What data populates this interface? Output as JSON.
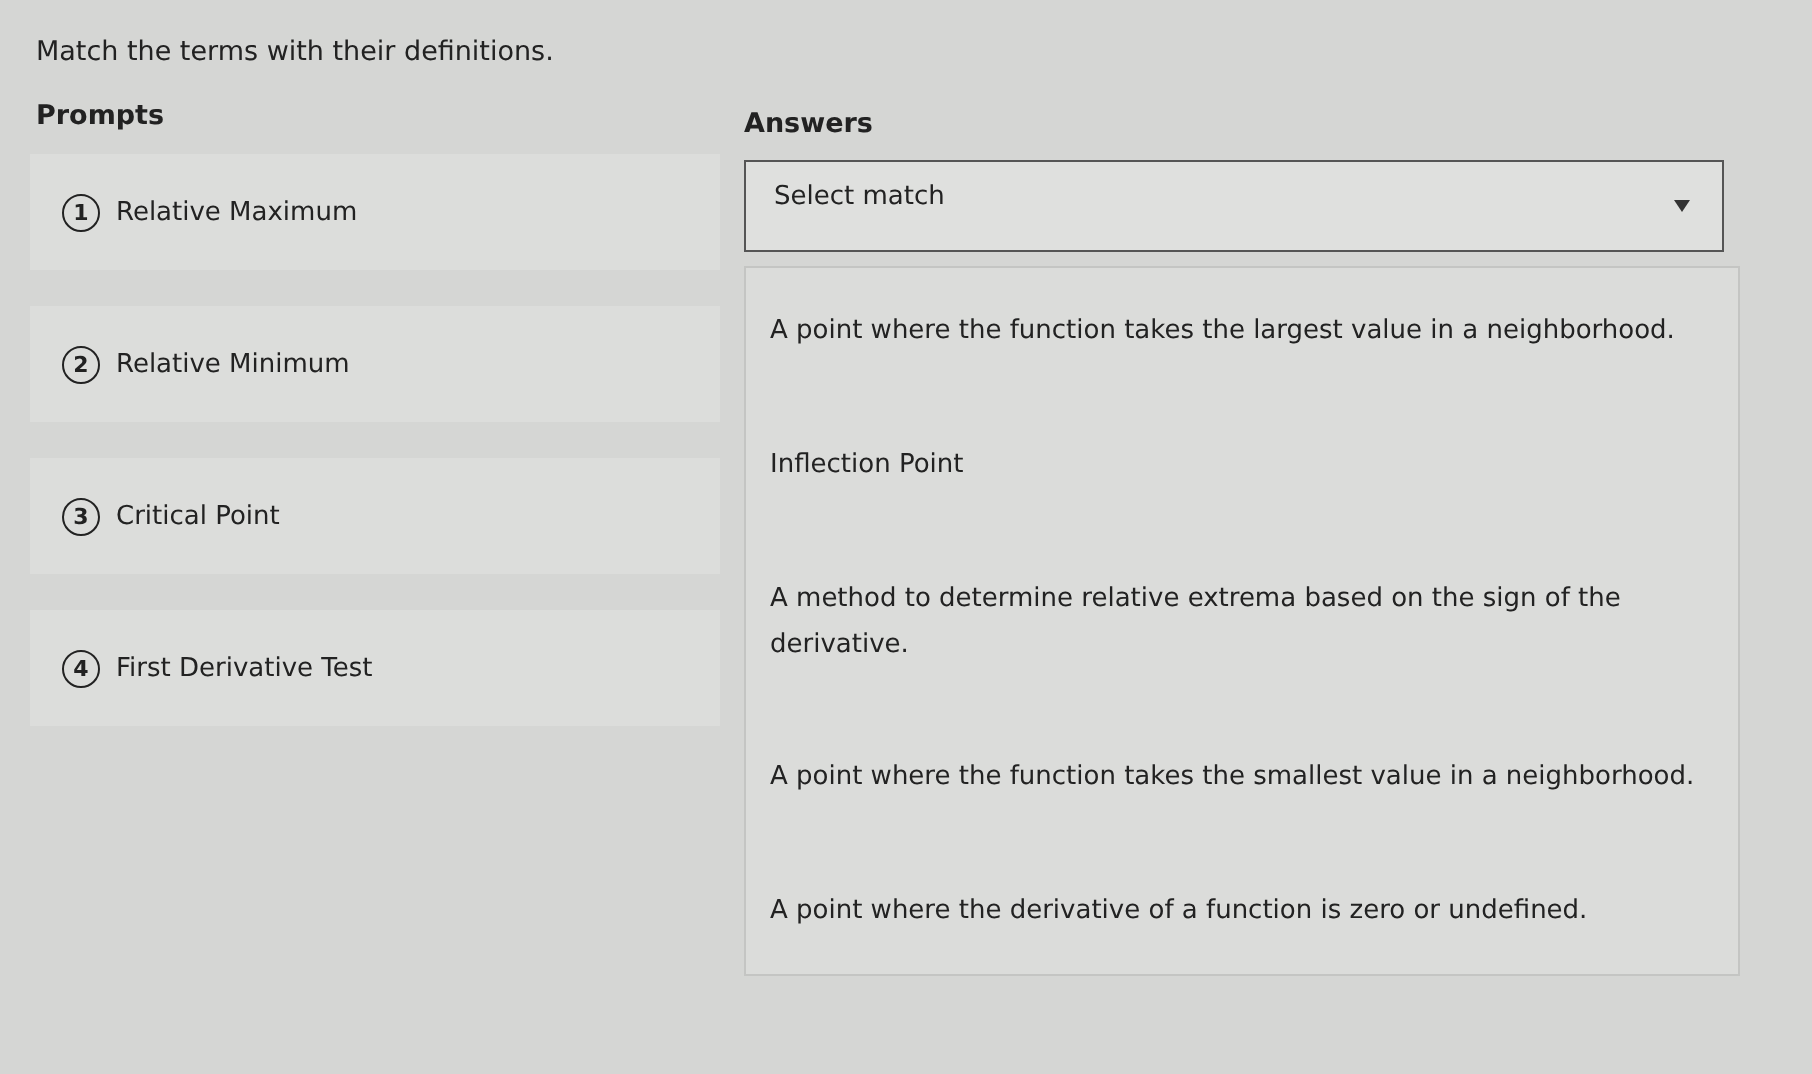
{
  "instruction": "Match the terms with their definitions.",
  "prompts": {
    "heading": "Prompts",
    "items": [
      {
        "number": "1",
        "term": "Relative Maximum"
      },
      {
        "number": "2",
        "term": "Relative Minimum"
      },
      {
        "number": "3",
        "term": "Critical Point"
      },
      {
        "number": "4",
        "term": "First Derivative Test"
      }
    ]
  },
  "answers": {
    "heading": "Answers",
    "select": {
      "placeholder": "Select match",
      "expanded": true
    },
    "options": [
      "A point where the function takes the largest value in a neighborhood.",
      "Inflection Point",
      "A method to determine relative extrema based on the sign of the derivative.",
      "A point where the function takes the smallest value in a neighborhood.",
      "A point where the derivative of a function is zero or undefined."
    ]
  }
}
